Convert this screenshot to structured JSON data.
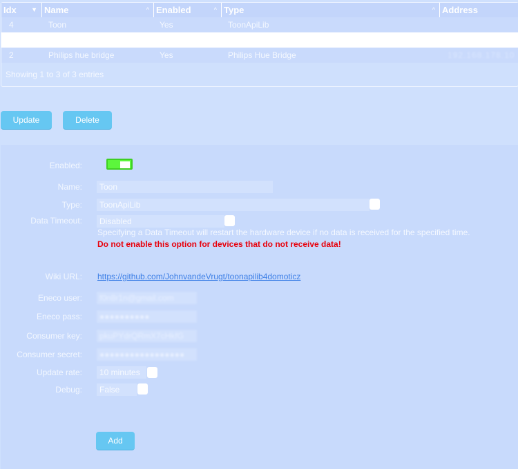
{
  "table": {
    "headers": [
      "Idx",
      "Name",
      "Enabled",
      "Type",
      "Address"
    ],
    "rows": [
      {
        "idx": "4",
        "name": "Toon",
        "enabled": "Yes",
        "type": "ToonApiLib",
        "address": ""
      },
      {
        "idx": "",
        "name": "",
        "enabled": "",
        "type": "",
        "address": ""
      },
      {
        "idx": "2",
        "name": "Philips hue bridge",
        "enabled": "Yes",
        "type": "Philips Hue Bridge",
        "address": "192.168.178.10"
      }
    ],
    "info": "Showing 1 to 3 of 3 entries"
  },
  "actions": {
    "update_label": "Update",
    "delete_label": "Delete"
  },
  "form": {
    "enabled_label": "Enabled:",
    "enabled_value": true,
    "name_label": "Name:",
    "name_value": "Toon",
    "type_label": "Type:",
    "type_value": "ToonApiLib",
    "timeout_label": "Data Timeout:",
    "timeout_value": "Disabled",
    "timeout_hint": "Specifying a Data Timeout will restart the hardware device if no data is received for the specified time.",
    "timeout_warning": "Do not enable this option for devices that do not receive data!",
    "wiki_label": "Wiki URL:",
    "wiki_url": "https://github.com/JohnvandeVrugt/toonapilib4domoticz",
    "eneco_user_label": "Eneco user:",
    "eneco_user_value": "f0n8r1n@gmail.com",
    "eneco_pass_label": "Eneco pass:",
    "eneco_pass_value": "●●●●●●●●●●",
    "consumer_key_label": "Consumer key:",
    "consumer_key_value": "pkuPYdrQRmX7cHkfG",
    "consumer_secret_label": "Consumer secret:",
    "consumer_secret_value": "●●●●●●●●●●●●●●●●●",
    "update_rate_label": "Update rate:",
    "update_rate_value": "10 minutes",
    "debug_label": "Debug:",
    "debug_value": "False",
    "add_label": "Add"
  },
  "colors": {
    "accent": "#66c7f2",
    "toggle_on": "#5cf63c",
    "warning": "#e8000b",
    "link": "#3d7fe6"
  }
}
